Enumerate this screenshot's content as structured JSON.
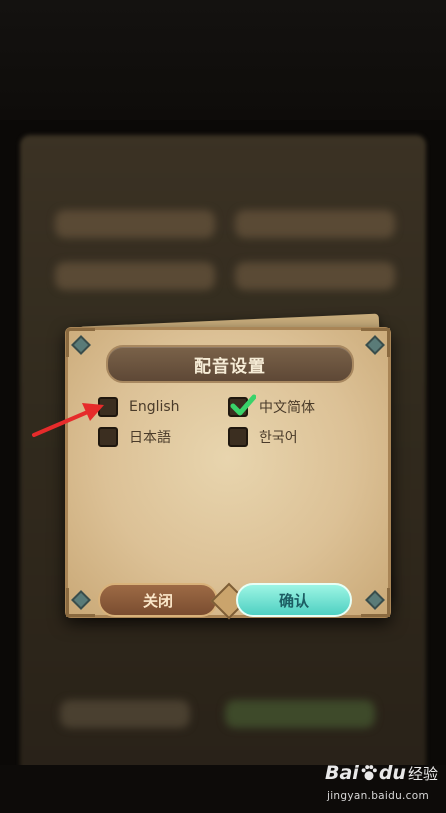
{
  "dialog": {
    "title": "配音设置",
    "options": [
      {
        "label": "English",
        "checked": false
      },
      {
        "label": "中文简体",
        "checked": true
      },
      {
        "label": "日本語",
        "checked": false
      },
      {
        "label": "한국어",
        "checked": false
      }
    ],
    "close_label": "关闭",
    "confirm_label": "确认"
  },
  "watermark": {
    "brand_bai": "Bai",
    "brand_du": "du",
    "brand_jingyan": "经验",
    "url": "jingyan.baidu.com"
  },
  "colors": {
    "check": "#39d36a",
    "arrow": "#e62b2b",
    "confirm": "#6fe0d2",
    "close": "#8c5b3a"
  },
  "icons": {
    "arrow": "red-pointer-arrow",
    "check": "green-checkmark-icon",
    "paw": "baidu-paw-icon"
  }
}
